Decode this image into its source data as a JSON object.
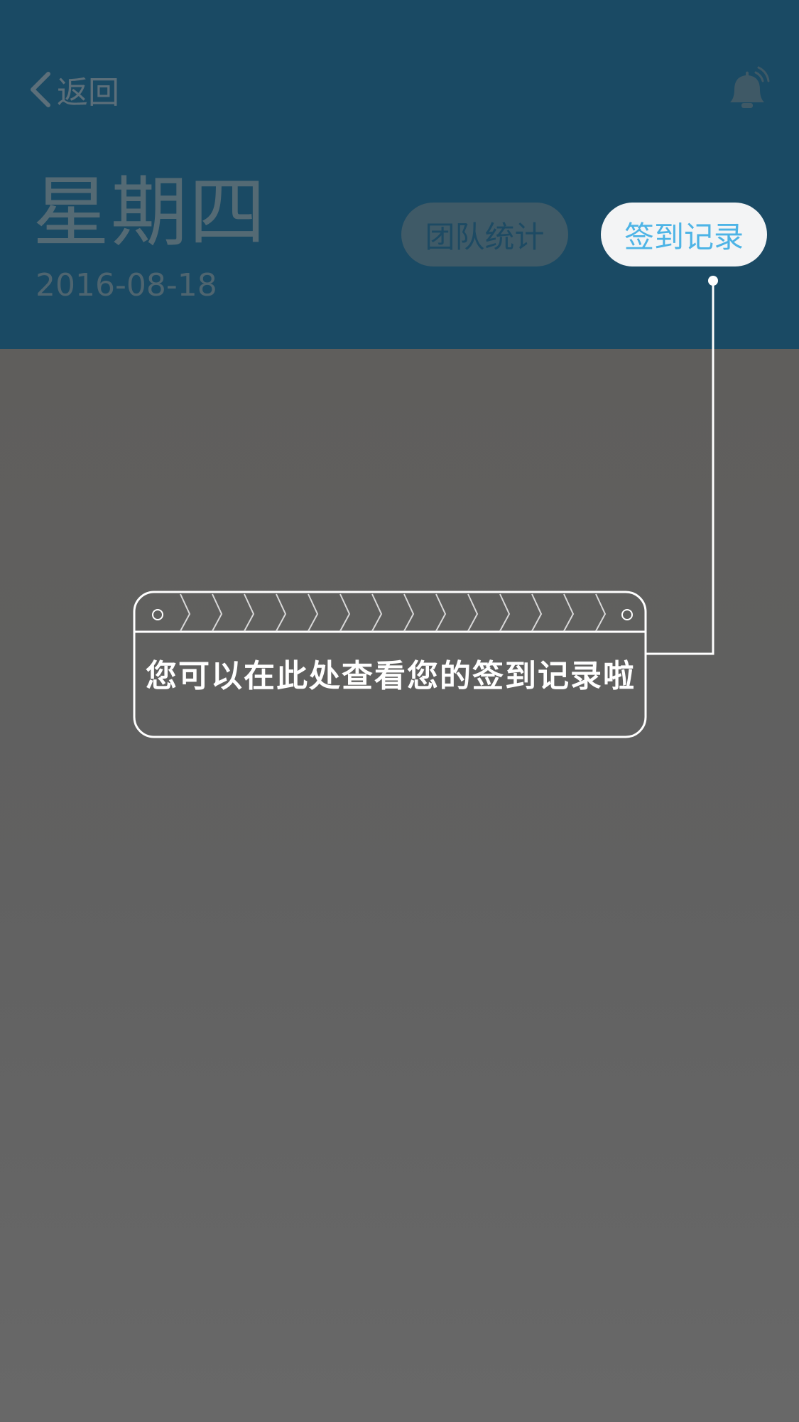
{
  "header": {
    "back_label": "返回",
    "weekday": "星期四",
    "date": "2016-08-18",
    "tabs": [
      {
        "label": "团队统计",
        "active": false
      },
      {
        "label": "签到记录",
        "active": true
      }
    ],
    "notification_icon": "bell-icon"
  },
  "tooltip": {
    "text": "您可以在此处查看您的签到记录啦"
  },
  "colors": {
    "header_bg": "#1a4a64",
    "overlay_bg": "#636363",
    "active_tab_text": "#4db4e6",
    "tooltip_stroke": "#ffffff"
  }
}
